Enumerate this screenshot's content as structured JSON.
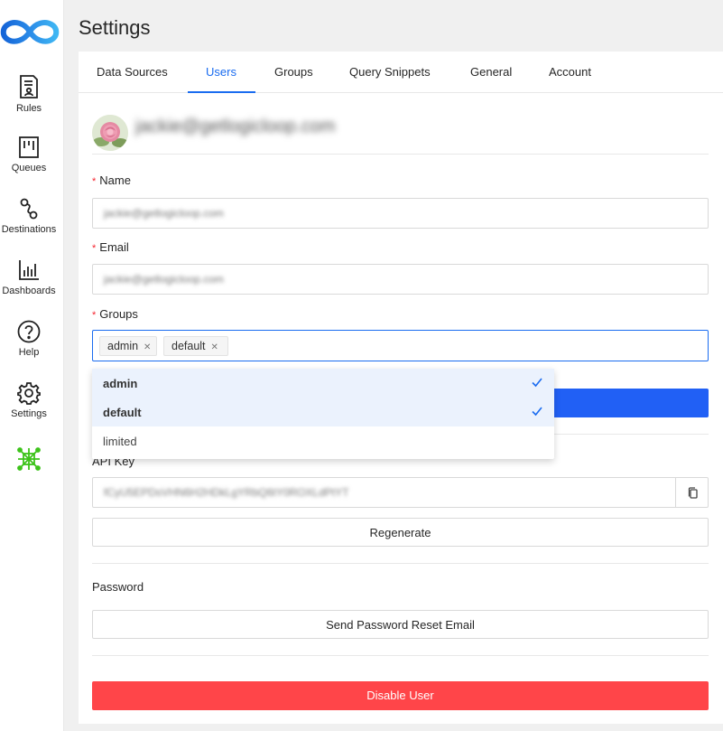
{
  "sidebar": {
    "items": [
      {
        "label": "Rules",
        "icon": "rules-icon"
      },
      {
        "label": "Queues",
        "icon": "queues-icon"
      },
      {
        "label": "Destinations",
        "icon": "destinations-icon"
      },
      {
        "label": "Dashboards",
        "icon": "dashboards-icon"
      },
      {
        "label": "Help",
        "icon": "help-icon"
      },
      {
        "label": "Settings",
        "icon": "gear-icon"
      }
    ],
    "extra_icon": "network-icon"
  },
  "page": {
    "title": "Settings"
  },
  "tabs": [
    {
      "label": "Data Sources"
    },
    {
      "label": "Users"
    },
    {
      "label": "Groups"
    },
    {
      "label": "Query Snippets"
    },
    {
      "label": "General"
    },
    {
      "label": "Account"
    }
  ],
  "active_tab": "Users",
  "user": {
    "email": "jackie@getlogicloop.com"
  },
  "form": {
    "name_label": "Name",
    "name_value": "jackie@getlogicloop.com",
    "email_label": "Email",
    "email_value": "jackie@getlogicloop.com",
    "groups_label": "Groups",
    "groups_selected": [
      "admin",
      "default"
    ],
    "required_mark": "*"
  },
  "groups_dropdown": {
    "options": [
      {
        "label": "admin",
        "selected": true
      },
      {
        "label": "default",
        "selected": true
      },
      {
        "label": "limited",
        "selected": false
      }
    ]
  },
  "api_key": {
    "label": "API Key",
    "value": "fCyU5EPDsVHN6H2HDkLgYRbQ6tY0ROXLdPtYT",
    "regenerate_label": "Regenerate"
  },
  "password": {
    "label": "Password",
    "reset_label": "Send Password Reset Email"
  },
  "disable_label": "Disable User",
  "colors": {
    "accent": "#1a6cf0",
    "primary_button": "#2160f5",
    "danger": "#ff4549",
    "required": "#f5222d",
    "logo_gradient": [
      "#1565d8",
      "#3fb6f3"
    ],
    "network_icon": "#3cc31a"
  }
}
